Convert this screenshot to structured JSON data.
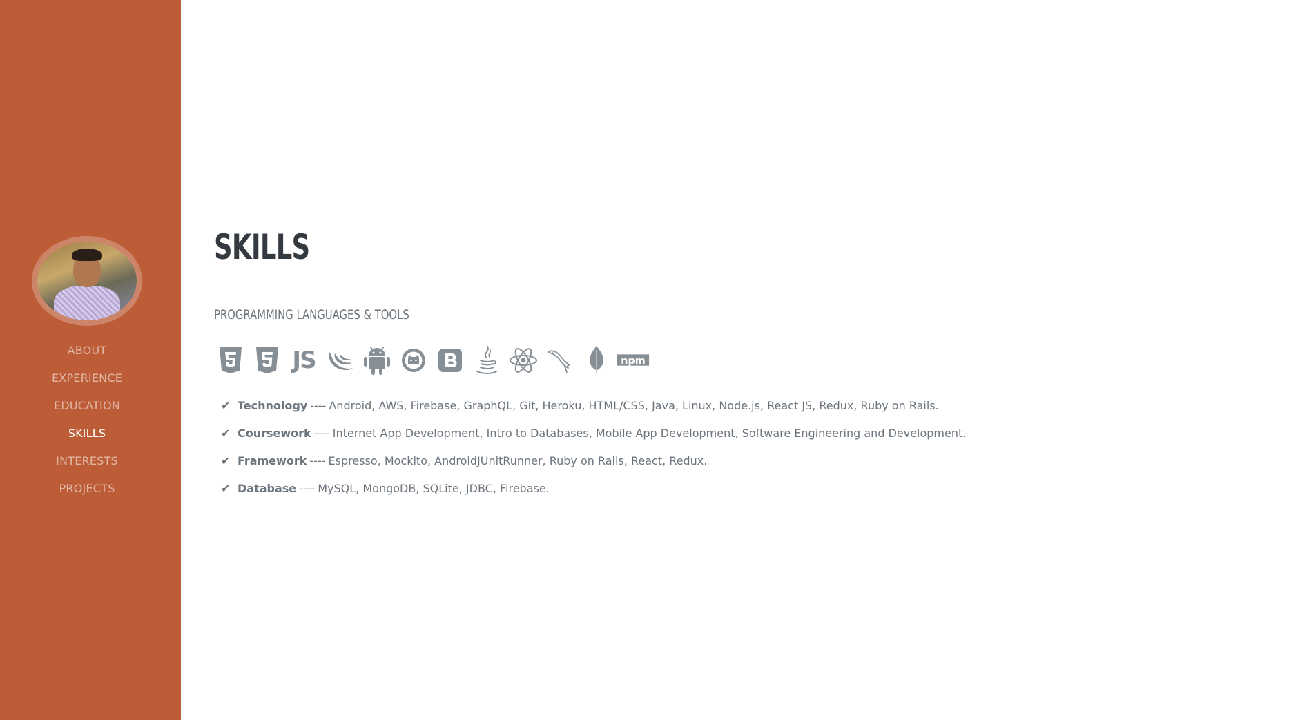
{
  "sidebar": {
    "background": "#bd5d38",
    "nav": [
      {
        "label": "About"
      },
      {
        "label": "Experience"
      },
      {
        "label": "Education"
      },
      {
        "label": "Skills"
      },
      {
        "label": "Interests"
      },
      {
        "label": "Projects"
      }
    ],
    "active": "Skills"
  },
  "main": {
    "title": "SKILLS",
    "subheading": "PROGRAMMING LANGUAGES & TOOLS",
    "icons": [
      "html5-icon",
      "css3-icon",
      "js-icon",
      "jquery-icon",
      "android-icon",
      "github-icon",
      "bootstrap-icon",
      "java-icon",
      "react-icon",
      "mysql-icon",
      "mongodb-icon",
      "npm-icon"
    ],
    "js_icon_text": "JS",
    "npm_icon_text": "npm",
    "skills": [
      {
        "name": "Technology",
        "separator": "----",
        "items": "Android, AWS, Firebase, GraphQL, Git, Heroku, HTML/CSS, Java, Linux, Node.js, React JS, Redux, Ruby on Rails."
      },
      {
        "name": "Coursework",
        "separator": "----",
        "items": "Internet App Development, Intro to Databases, Mobile App Development, Software Engineering and Development."
      },
      {
        "name": "Framework",
        "separator": "----",
        "items": "Espresso, Mockito, AndroidJUnitRunner, Ruby on Rails, React, Redux."
      },
      {
        "name": "Database",
        "separator": "----",
        "items": "MySQL, MongoDB, SQLite, JDBC, Firebase."
      }
    ]
  }
}
